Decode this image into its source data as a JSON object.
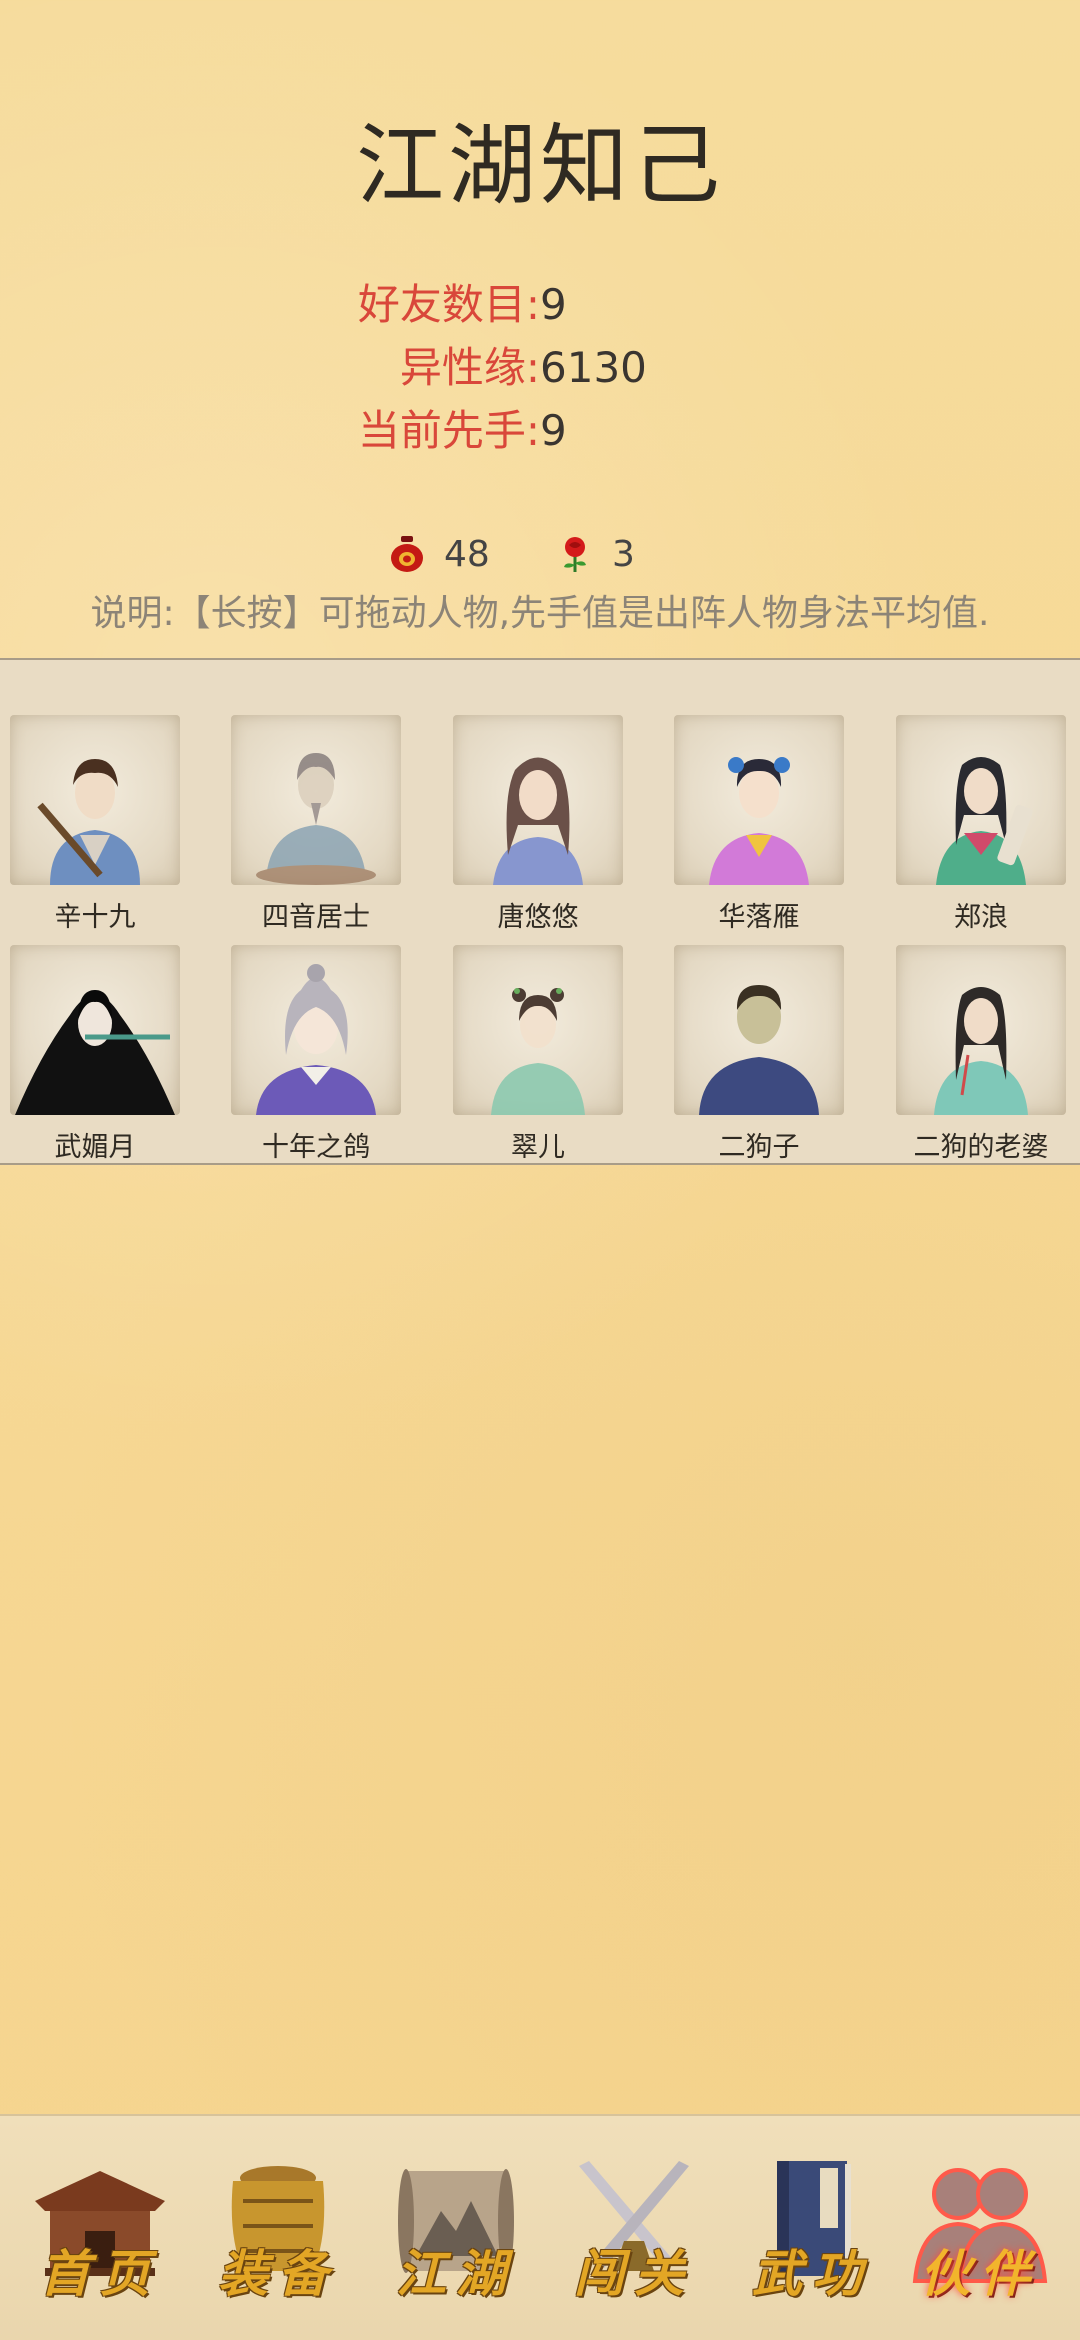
{
  "page": {
    "title": "江湖知己"
  },
  "stats": {
    "friends_label": "好友数目:",
    "friends_value": "9",
    "affinity_label": "异性缘:",
    "affinity_value": "6130",
    "initiative_label": "当前先手:",
    "initiative_value": "9"
  },
  "resources": {
    "wine_count": "48",
    "rose_count": "3",
    "wine_icon": "wine-jar-icon",
    "rose_icon": "rose-icon"
  },
  "note": "说明:【长按】可拖动人物,先手值是出阵人物身法平均值.",
  "members": [
    {
      "name": "辛十九",
      "icon": "swordsman-portrait"
    },
    {
      "name": "四音居士",
      "icon": "hermit-portrait"
    },
    {
      "name": "唐悠悠",
      "icon": "lady-portrait"
    },
    {
      "name": "华落雁",
      "icon": "girl-portrait"
    },
    {
      "name": "郑浪",
      "icon": "scholar-portrait"
    },
    {
      "name": "武媚月",
      "icon": "flute-player-portrait"
    },
    {
      "name": "十年之鸽",
      "icon": "young-man-portrait"
    },
    {
      "name": "翠儿",
      "icon": "maid-portrait"
    },
    {
      "name": "二狗子",
      "icon": "villager-portrait"
    },
    {
      "name": "二狗的老婆",
      "icon": "village-woman-portrait"
    }
  ],
  "nav": {
    "items": [
      {
        "label": "首页",
        "icon": "house-icon"
      },
      {
        "label": "装备",
        "icon": "armor-icon"
      },
      {
        "label": "江湖",
        "icon": "scroll-map-icon"
      },
      {
        "label": "闯关",
        "icon": "crossed-swords-icon"
      },
      {
        "label": "武功",
        "icon": "book-icon"
      },
      {
        "label": "伙伴",
        "icon": "partners-icon"
      }
    ],
    "active": "伙伴"
  },
  "colors": {
    "label_red": "#d9473a",
    "panel_bg": "#e9dcc4",
    "nav_gold": "#e3a625"
  }
}
